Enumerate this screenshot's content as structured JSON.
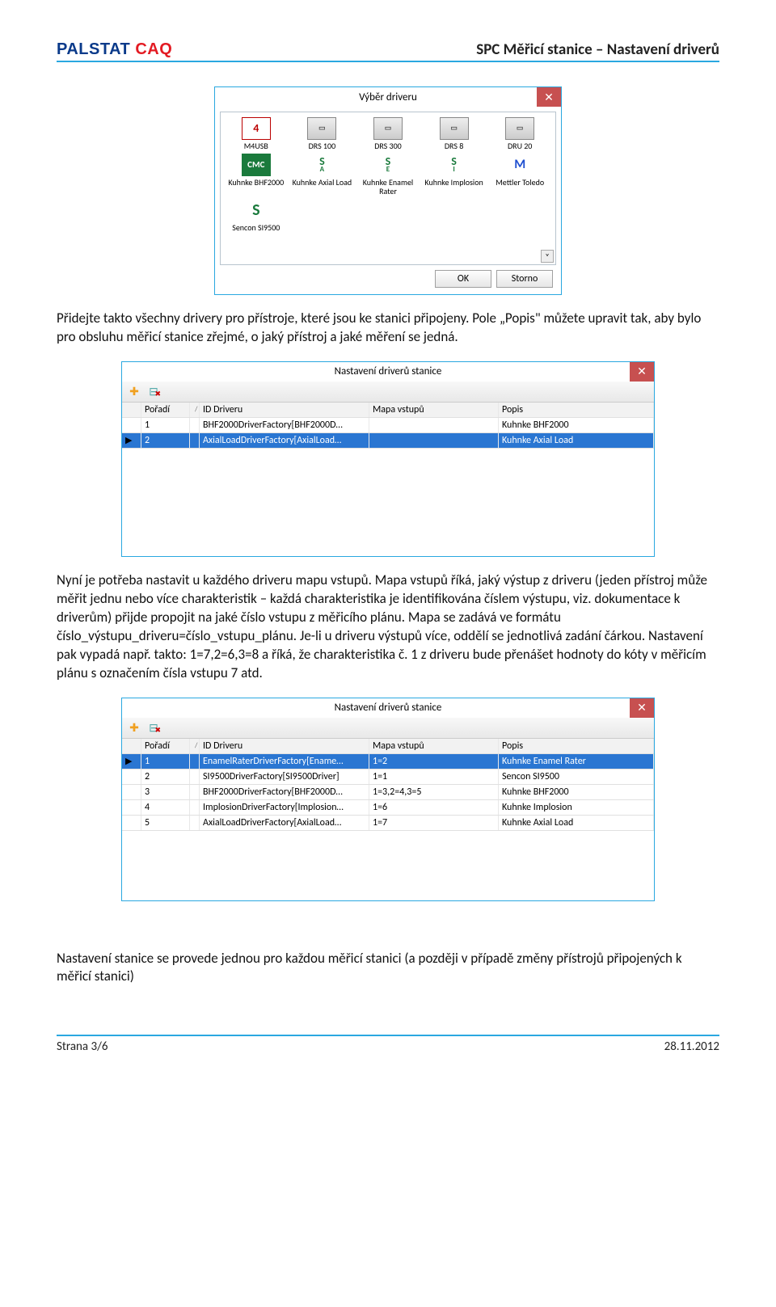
{
  "header": {
    "logo_a": "PALSTAT ",
    "logo_b": "CAQ",
    "title": "SPC Měřicí stanice – Nastavení driverů"
  },
  "footer": {
    "page": "Strana 3/6",
    "date": "28.11.2012"
  },
  "text": {
    "p1": "Přidejte takto všechny drivery pro přístroje, které jsou ke stanici připojeny. Pole „Popis\" můžete upravit tak, aby bylo pro obsluhu měřicí stanice zřejmé, o jaký přístroj a jaké měření se jedná.",
    "p2": "Nyní je potřeba nastavit u každého driveru mapu vstupů. Mapa vstupů říká, jaký výstup z driveru (jeden přístroj může měřit jednu nebo více charakteristik – každá charakteristika je identifikována číslem výstupu, viz. dokumentace k driverům) přijde propojit na jaké číslo vstupu z měřicího plánu. Mapa se zadává ve formátu číslo_výstupu_driveru=číslo_vstupu_plánu. Je-li u driveru výstupů více, oddělí se jednotlivá zadání čárkou. Nastavení pak vypadá např. takto: 1=7,2=6,3=8 a říká, že charakteristika č. 1 z driveru bude přenášet hodnoty do kóty v měřicím plánu s označením čísla vstupu 7 atd.",
    "p3": "Nastavení stanice se provede jednou pro každou měřicí stanici (a později v případě změny přístrojů připojených k měřicí stanici)"
  },
  "win1": {
    "title": "Výběr driveru",
    "ok": "OK",
    "cancel": "Storno",
    "items": [
      {
        "icon": "m4",
        "label": "M4USB",
        "glyph": "4"
      },
      {
        "icon": "drs",
        "label": "DRS 100",
        "glyph": ""
      },
      {
        "icon": "drs",
        "label": "DRS 300",
        "glyph": ""
      },
      {
        "icon": "drs",
        "label": "DRS 8",
        "glyph": ""
      },
      {
        "icon": "drs",
        "label": "DRU 20",
        "glyph": ""
      },
      {
        "icon": "cmc",
        "label": "Kuhnke BHF2000",
        "glyph": "CMC"
      },
      {
        "icon": "sa",
        "label": "Kuhnke Axial Load",
        "glyph": "A"
      },
      {
        "icon": "sa",
        "label": "Kuhnke Enamel Rater",
        "glyph": "E"
      },
      {
        "icon": "sa",
        "label": "Kuhnke Implosion",
        "glyph": "I"
      },
      {
        "icon": "m",
        "label": "Mettler Toledo",
        "glyph": "M"
      },
      {
        "icon": "s",
        "label": "Sencon SI9500",
        "glyph": "S"
      }
    ]
  },
  "gridHeaders": {
    "poradi": "Pořadí",
    "sort": "/",
    "id": "ID Driveru",
    "mapa": "Mapa vstupů",
    "popis": "Popis"
  },
  "win2": {
    "title": "Nastavení driverů stanice",
    "rows": [
      {
        "n": "1",
        "id": "BHF2000DriverFactory[BHF2000D…",
        "mapa": "",
        "popis": "Kuhnke BHF2000",
        "sel": false
      },
      {
        "n": "2",
        "id": "AxialLoadDriverFactory[AxialLoad…",
        "mapa": "",
        "popis": "Kuhnke Axial Load",
        "sel": true
      }
    ]
  },
  "win3": {
    "title": "Nastavení driverů stanice",
    "rows": [
      {
        "n": "1",
        "id": "EnamelRaterDriverFactory[Ename…",
        "mapa": "1=2",
        "popis": "Kuhnke Enamel Rater",
        "sel": true
      },
      {
        "n": "2",
        "id": "SI9500DriverFactory[SI9500Driver]",
        "mapa": "1=1",
        "popis": "Sencon SI9500",
        "sel": false
      },
      {
        "n": "3",
        "id": "BHF2000DriverFactory[BHF2000D…",
        "mapa": "1=3,2=4,3=5",
        "popis": "Kuhnke BHF2000",
        "sel": false
      },
      {
        "n": "4",
        "id": "ImplosionDriverFactory[Implosion…",
        "mapa": "1=6",
        "popis": "Kuhnke Implosion",
        "sel": false
      },
      {
        "n": "5",
        "id": "AxialLoadDriverFactory[AxialLoad…",
        "mapa": "1=7",
        "popis": "Kuhnke Axial Load",
        "sel": false
      }
    ]
  }
}
